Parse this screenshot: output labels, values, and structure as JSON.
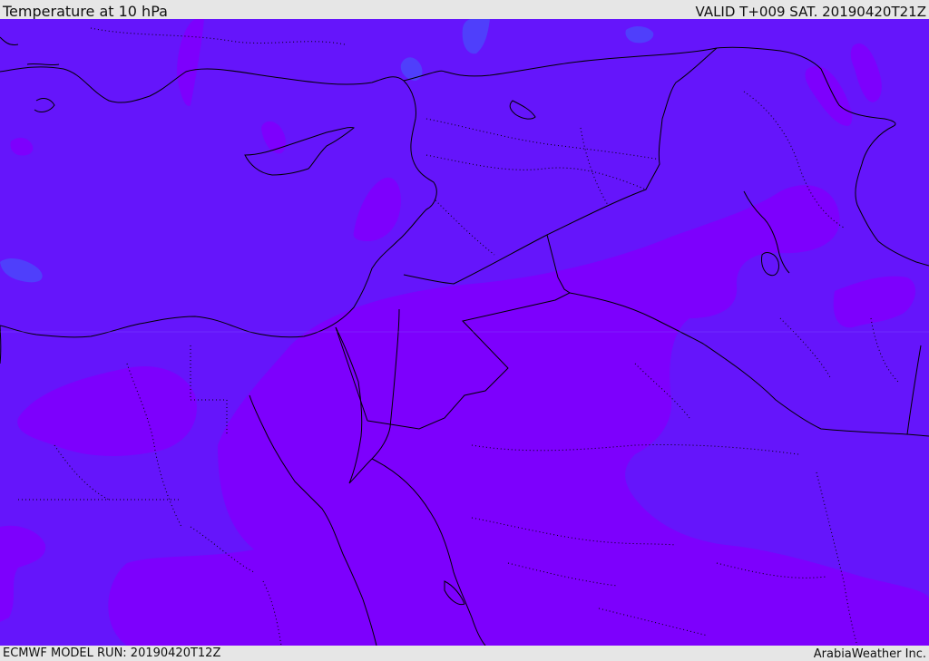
{
  "header": {
    "title": "Temperature at 10 hPa",
    "valid": "VALID T+009 SAT. 20190420T21Z"
  },
  "footer": {
    "model_run": "ECMWF MODEL RUN: 20190420T12Z",
    "credit": "ArabiaWeather Inc."
  },
  "colors": {
    "base_field": "#6515fb",
    "warm_field": "#7d00fd",
    "cool_patch": "#4f3ffb",
    "border_line": "#000000"
  }
}
